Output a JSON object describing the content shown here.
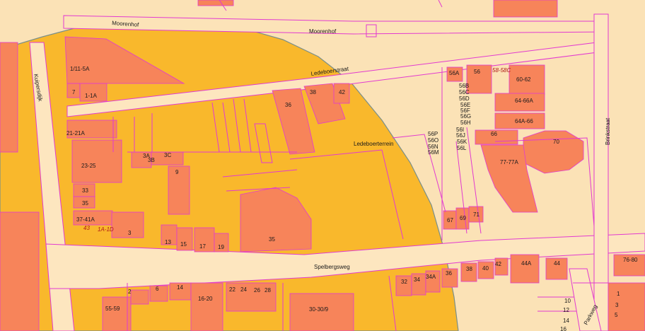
{
  "colors": {
    "background": "#fbe2b6",
    "zone_fill": "#f9b82c",
    "zone_border": "#7a8f8a",
    "building": "#f7845a",
    "parcel_line": "#e23ad0",
    "road": "#fde6bf"
  },
  "streets": {
    "moorenhof_1": "Moorenhof",
    "moorenhof_2": "Moorenhof",
    "ledeboerstraat": "Ledeboerstraat",
    "kuipersdijk": "Kuipersdijk",
    "brinkstraat": "Brinkstraat",
    "spelbergsweg": "Spelbergsweg",
    "parkweg": "Parkweg",
    "ledeboerterrein": "Ledeboerterrein"
  },
  "house_numbers": {
    "n_1_11_5A": "1/11-5A",
    "n_7": "7",
    "n_1_1A": "1-1A",
    "n_21_21A": "21-21A",
    "n_23_25": "23-25",
    "n_33": "33",
    "n_35w": "35",
    "n_37_41A": "37-41A",
    "n_43": "43",
    "n_1A_1D": "1A-1D",
    "n_3A": "3A",
    "n_3B": "3B",
    "n_3C": "3C",
    "n_9": "9",
    "n_3": "3",
    "n_13": "13",
    "n_15": "15",
    "n_17": "17",
    "n_19": "19",
    "n_35": "35",
    "n_36": "36",
    "n_38": "38",
    "n_42": "42",
    "n_56A": "56A",
    "n_56": "56",
    "n_58_58C": "58-58C",
    "n_60_62": "60-62",
    "n_56B": "56B",
    "n_56C": "56C",
    "n_56D": "56D",
    "n_56E": "56E",
    "n_56F": "56F",
    "n_56G": "56G",
    "n_56H": "56H",
    "n_64_66A": "64-66A",
    "n_64A_66": "64A-66",
    "n_56I": "56I",
    "n_56J": "56J",
    "n_56K": "56K",
    "n_56L": "56L",
    "n_56P": "56P",
    "n_56O": "56O",
    "n_56N": "56N",
    "n_56M": "56M",
    "n_66": "66",
    "n_77_77A": "77-77A",
    "n_70": "70",
    "n_67": "67",
    "n_69": "69",
    "n_71": "71",
    "n_2": "2",
    "n_6": "6",
    "n_14": "14",
    "n_16_20": "16-20",
    "n_22": "22",
    "n_24": "24",
    "n_26": "26",
    "n_28": "28",
    "n_55_59": "55-59",
    "n_30_30_9": "30-30/9",
    "n_32": "32",
    "n_34": "34",
    "n_34A": "34A",
    "n_36s": "36",
    "n_38s": "38",
    "n_40": "40",
    "n_42s": "42",
    "n_44A": "44A",
    "n_44": "44",
    "n_76_80": "76-80",
    "n_1e": "1",
    "n_3e": "3",
    "n_5e": "5",
    "n_10": "10",
    "n_12": "12",
    "n_14e": "14",
    "n_16e": "16"
  }
}
